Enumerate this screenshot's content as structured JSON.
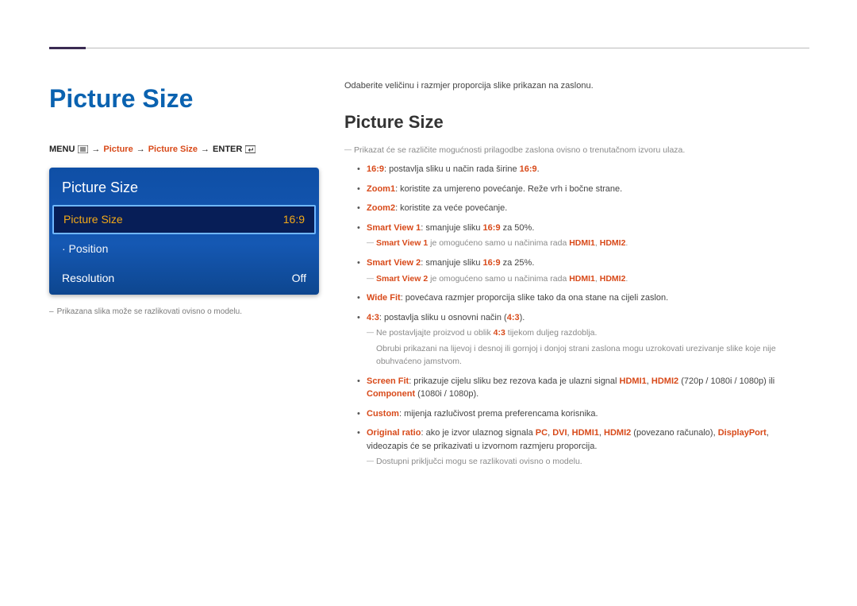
{
  "page_title": "Picture Size",
  "breadcrumb": {
    "menu_label": "MENU",
    "arrow": "→",
    "p1": "Picture",
    "p2": "Picture Size",
    "enter_label": "ENTER"
  },
  "osd": {
    "header": "Picture Size",
    "rows": [
      {
        "label": "Picture Size",
        "value": "16:9",
        "selected": true
      },
      {
        "label": "· Position",
        "value": ""
      },
      {
        "label": "Resolution",
        "value": "Off"
      }
    ]
  },
  "left_note": "Prikazana slika može se razlikovati ovisno o modelu.",
  "intro": "Odaberite veličinu i razmjer proporcija slike prikazan na zaslonu.",
  "section_title": "Picture Size",
  "top_dash": "Prikazat će se različite mogućnosti prilagodbe zaslona ovisno o trenutačnom izvoru ulaza.",
  "opts": {
    "o169_k": "16:9",
    "o169_t": ": postavlja sliku u način rada širine ",
    "o169_k2": "16:9",
    "o169_t2": ".",
    "zoom1_k": "Zoom1",
    "zoom1_t": ": koristite za umjereno povećanje. Reže vrh i bočne strane.",
    "zoom2_k": "Zoom2",
    "zoom2_t": ": koristite za veće povećanje.",
    "sv1_k": "Smart View 1",
    "sv1_t": ": smanjuje sliku ",
    "sv1_k2": "16:9",
    "sv1_t2": " za 50%.",
    "sv1_note_a": "Smart View 1",
    "sv1_note_b": "  je omogućeno samo u načinima rada ",
    "sv1_note_c": "HDMI1",
    "sv1_note_comma": ", ",
    "sv1_note_d": "HDMI2",
    "sv1_note_e": ".",
    "sv2_k": "Smart View 2",
    "sv2_t": ": smanjuje sliku ",
    "sv2_k2": "16:9",
    "sv2_t2": " za 25%.",
    "sv2_note_a": "Smart View 2",
    "sv2_note_b": "  je omogućeno samo u načinima rada ",
    "sv2_note_c": "HDMI1",
    "sv2_note_comma": ", ",
    "sv2_note_d": "HDMI2",
    "sv2_note_e": ".",
    "wf_k": "Wide Fit",
    "wf_t": ": povećava razmjer proporcija slike tako da ona stane na cijeli zaslon.",
    "r43_k": "4:3",
    "r43_t": ": postavlja sliku u osnovni način (",
    "r43_k2": "4:3",
    "r43_t2": ").",
    "r43_note1_a": "Ne postavljajte proizvod u oblik ",
    "r43_note1_b": "4:3",
    "r43_note1_c": " tijekom duljeg razdoblja.",
    "r43_note2": "Obrubi prikazani na lijevoj i desnoj ili gornjoj i donjoj strani zaslona mogu uzrokovati urezivanje slike koje nije obuhvaćeno jamstvom.",
    "sf_k": "Screen Fit",
    "sf_t1": ": prikazuje cijelu sliku bez rezova kada je ulazni signal ",
    "sf_h1": "HDMI1",
    "sf_c": ", ",
    "sf_h2": "HDMI2",
    "sf_t2": " (720p / 1080i / 1080p) ili ",
    "sf_comp": "Component",
    "sf_t3": " (1080i / 1080p).",
    "cust_k": "Custom",
    "cust_t": ": mijenja razlučivost prema preferencama korisnika.",
    "or_k": "Original ratio",
    "or_t1": ": ako je izvor ulaznog signala ",
    "or_pc": "PC",
    "or_c1": ", ",
    "or_dvi": "DVI",
    "or_c2": ", ",
    "or_h1": "HDMI1",
    "or_c3": ", ",
    "or_h2": "HDMI2",
    "or_t2": " (povezano računalo), ",
    "or_dp": "DisplayPort",
    "or_t3": ", videozapis će se prikazivati u izvornom razmjeru proporcija.",
    "or_note": "Dostupni priključci mogu se razlikovati ovisno o modelu."
  }
}
